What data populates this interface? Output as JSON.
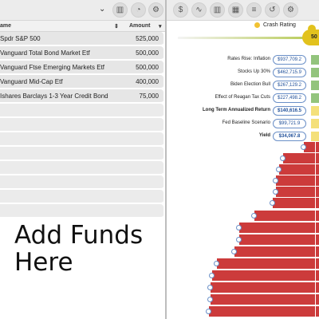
{
  "left_panel": {
    "toolbar": {
      "chevron": "⌄",
      "buttons": [
        "chart-icon",
        "pie-icon",
        "gear-icon"
      ]
    },
    "header": {
      "name_col": "ame",
      "amount_col": "Amount"
    },
    "funds": [
      {
        "name": "Spdr S&P 500",
        "amount": "525,000"
      },
      {
        "name": "Vanguard Total Bond Market Etf",
        "amount": "500,000"
      },
      {
        "name": "Vanguard Ftse Emerging Markets Etf",
        "amount": "500,000"
      },
      {
        "name": "Vanguard Mid-Cap Etf",
        "amount": "400,000"
      },
      {
        "name": "Ishares Barclays 1-3 Year Credit Bond",
        "amount": "75,000"
      }
    ],
    "empty_rows": 8,
    "add_funds_text": "Add Funds Here"
  },
  "right_panel": {
    "toolbar": {
      "buttons": [
        "dollar-icon",
        "line-icon",
        "grid-icon",
        "list-icon",
        "undo-icon",
        "settings-icon"
      ]
    },
    "crash_rating_label": "Crash Rating",
    "crash_rating_value": "50",
    "scenarios": [
      {
        "label": "Rates Rise: Inflation",
        "value": "$937,709.2",
        "bold": false
      },
      {
        "label": "Stocks Up 30%",
        "value": "$462,715.9",
        "bold": false
      },
      {
        "label": "Biden Election Bull",
        "value": "$267,129.2",
        "bold": false
      },
      {
        "label": "Effect of Reagan Tax Cuts",
        "value": "$227,498.2",
        "bold": false
      },
      {
        "label": "Long Term Annualized Return",
        "value": "$140,616.5",
        "bold": true
      },
      {
        "label": "Fed Baseline Scenario",
        "value": "$99,721.9",
        "bold": false
      },
      {
        "label": "Yield",
        "value": "$34,067.8",
        "bold": true
      }
    ]
  },
  "colors": {
    "loss_bar": "#cc3b3b",
    "gain_bar": "#93c47d",
    "accent_yellow": "#e2c21d",
    "pill_border": "#6a8fc7"
  }
}
